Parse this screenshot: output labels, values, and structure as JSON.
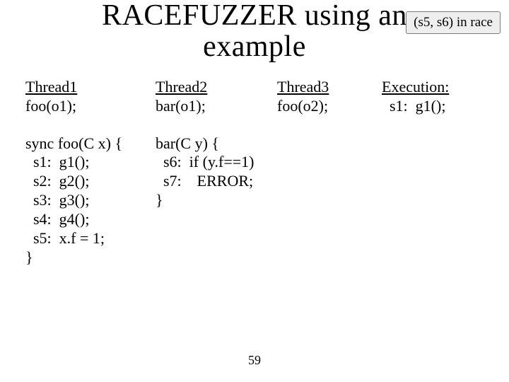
{
  "title_line1": "RACEFUZZER using an",
  "title_line2": "example",
  "badge": "(s5, s6) in race",
  "col1": {
    "header": "Thread1",
    "call": "foo(o1);",
    "body": "sync foo(C x) {\n  s1:  g1();\n  s2:  g2();\n  s3:  g3();\n  s4:  g4();\n  s5:  x.f = 1;\n}"
  },
  "col2": {
    "header": "Thread2",
    "call": "bar(o1);",
    "body": "bar(C y) {\n  s6:  if (y.f==1)\n  s7:    ERROR;\n}"
  },
  "col3": {
    "header": "Thread3",
    "call": "foo(o2);"
  },
  "col4": {
    "header": "Execution:",
    "line": "  s1:  g1();"
  },
  "page_number": "59"
}
